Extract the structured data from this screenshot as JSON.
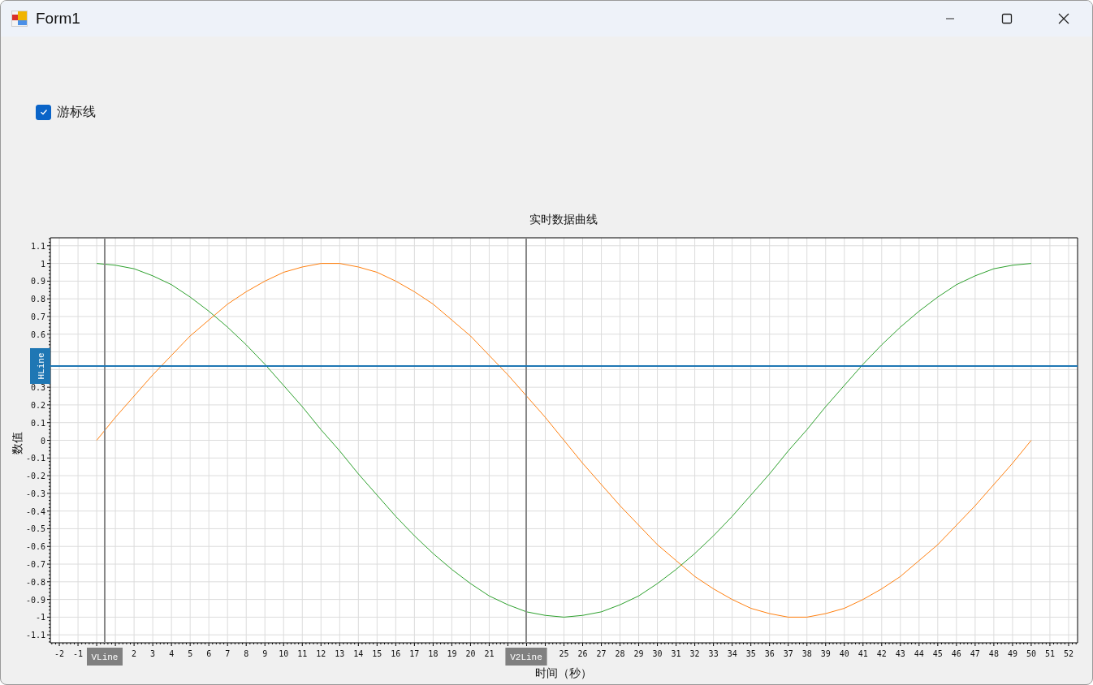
{
  "window": {
    "title": "Form1"
  },
  "cursor_checkbox": {
    "label": "游标线",
    "checked": true
  },
  "chart": {
    "chart_data": {
      "type": "line",
      "title": "实时数据曲线",
      "xlabel": "时间（秒）",
      "ylabel": "数值",
      "x": [
        0,
        1,
        2,
        3,
        4,
        5,
        6,
        7,
        8,
        9,
        10,
        11,
        12,
        13,
        14,
        15,
        16,
        17,
        18,
        19,
        20,
        21,
        22,
        23,
        24,
        25,
        26,
        27,
        28,
        29,
        30,
        31,
        32,
        33,
        34,
        35,
        36,
        37,
        38,
        39,
        40,
        41,
        42,
        43,
        44,
        45,
        46,
        47,
        48,
        49,
        50
      ],
      "series": [
        {
          "color": "#2ca02c",
          "values": [
            1,
            0.99,
            0.97,
            0.93,
            0.88,
            0.81,
            0.73,
            0.64,
            0.54,
            0.43,
            0.31,
            0.19,
            0.06,
            -0.06,
            -0.19,
            -0.31,
            -0.43,
            -0.54,
            -0.64,
            -0.73,
            -0.81,
            -0.88,
            -0.93,
            -0.97,
            -0.99,
            -1,
            -0.99,
            -0.97,
            -0.93,
            -0.88,
            -0.81,
            -0.73,
            -0.64,
            -0.54,
            -0.43,
            -0.31,
            -0.19,
            -0.06,
            0.06,
            0.19,
            0.31,
            0.43,
            0.54,
            0.64,
            0.73,
            0.81,
            0.88,
            0.93,
            0.97,
            0.99,
            1
          ]
        },
        {
          "color": "#ff7f0e",
          "values": [
            0,
            0.13,
            0.25,
            0.37,
            0.48,
            0.59,
            0.68,
            0.77,
            0.84,
            0.9,
            0.95,
            0.98,
            1,
            1,
            0.98,
            0.95,
            0.9,
            0.84,
            0.77,
            0.68,
            0.59,
            0.48,
            0.37,
            0.25,
            0.13,
            0,
            -0.13,
            -0.25,
            -0.37,
            -0.48,
            -0.59,
            -0.68,
            -0.77,
            -0.84,
            -0.9,
            -0.95,
            -0.98,
            -1,
            -1,
            -0.98,
            -0.95,
            -0.9,
            -0.84,
            -0.77,
            -0.68,
            -0.59,
            -0.48,
            -0.37,
            -0.25,
            -0.13,
            0
          ]
        }
      ],
      "xlim": [
        -2.48,
        52.48
      ],
      "ylim": [
        -1.145,
        1.145
      ],
      "xticks": [
        -2,
        -1,
        2,
        3,
        4,
        5,
        6,
        7,
        8,
        9,
        10,
        11,
        12,
        13,
        14,
        15,
        16,
        17,
        18,
        19,
        20,
        21,
        25,
        26,
        27,
        28,
        29,
        30,
        31,
        32,
        33,
        34,
        35,
        36,
        37,
        38,
        39,
        40,
        41,
        42,
        43,
        44,
        45,
        46,
        47,
        48,
        49,
        50,
        51,
        52
      ],
      "yticks": [
        1.1,
        1,
        0.9,
        0.8,
        0.7,
        0.6,
        0.3,
        0.2,
        0.1,
        0,
        -0.1,
        -0.2,
        -0.3,
        -0.4,
        -0.5,
        -0.6,
        -0.7,
        -0.8,
        -0.9,
        -1,
        -1.1
      ],
      "grid": true,
      "ref_lines": [
        {
          "axis": "x",
          "value": 0.43,
          "label": "VLine"
        },
        {
          "axis": "x",
          "value": 22.98,
          "label": "V2Line"
        },
        {
          "axis": "y",
          "value": 0.42,
          "label": "HLine"
        }
      ]
    }
  }
}
